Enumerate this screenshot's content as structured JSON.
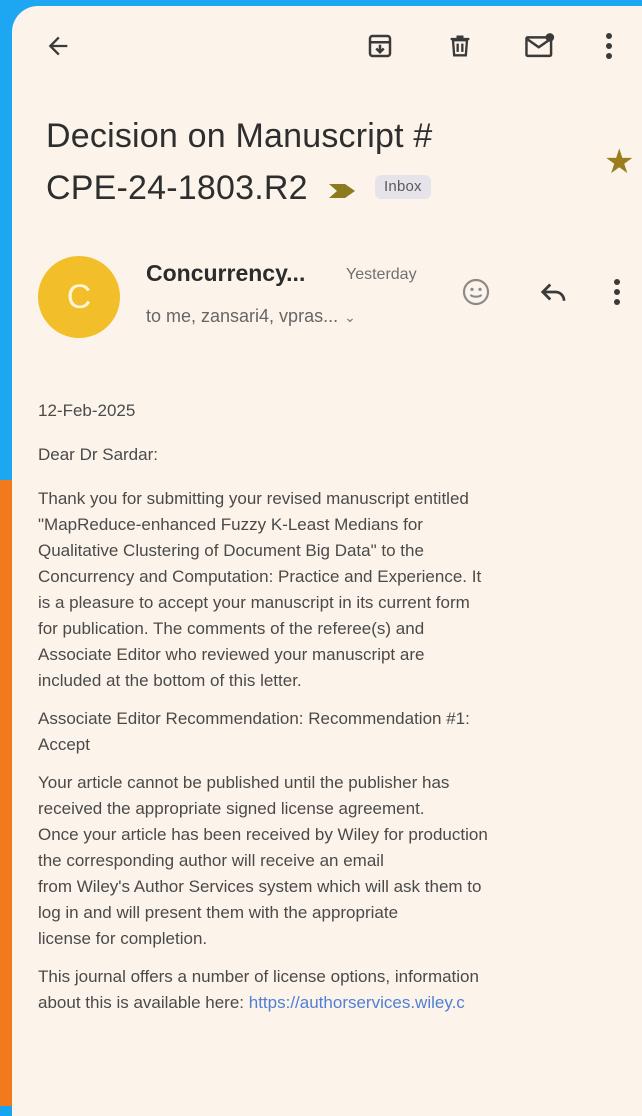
{
  "toolbar": {
    "back": "back-arrow-icon",
    "archive": "archive-icon",
    "delete": "trash-icon",
    "mark_unread": "mark-unread-icon",
    "more": "more-vert-icon"
  },
  "email": {
    "subject_line1": "Decision on Manuscript #",
    "subject_line2": "CPE-24-1803.R2",
    "label": "Inbox",
    "starred": true,
    "sender": {
      "initial": "C",
      "name": "Concurrency...",
      "time": "Yesterday",
      "recipients": "to me, zansari4, vpras..."
    },
    "body": {
      "date": "12-Feb-2025",
      "greeting": "Dear Dr Sardar:",
      "para1": "Thank you for submitting your revised manuscript entitled\n\"MapReduce-enhanced Fuzzy K-Least Medians for\nQualitative Clustering of Document Big Data\" to the\nConcurrency and Computation: Practice and Experience. It\nis a pleasure to accept your manuscript in its current form\nfor publication. The comments of the referee(s) and\nAssociate Editor who reviewed your manuscript are\nincluded at the bottom of this letter.",
      "para2": "Associate Editor Recommendation: Recommendation #1:\nAccept",
      "para3": "Your article cannot be published until the publisher has\nreceived the appropriate signed license agreement.\nOnce your article has been received by Wiley for production\nthe corresponding author will receive an email\nfrom Wiley's Author Services system which will ask them to\nlog in and will present them with the appropriate\nlicense for completion.",
      "para4_text": "This journal offers a number of license options, information\nabout this is available here: ",
      "para4_link": "https://authorservices.wiley.c"
    }
  },
  "colors": {
    "background_blue": "#1da6f2",
    "background_orange": "#f07a1c",
    "screen_bg": "#fcf4ea",
    "avatar": "#f2bf2a",
    "star": "#9a7d1e",
    "important_marker": "#8c7a1c",
    "link": "#4f7fd6"
  }
}
